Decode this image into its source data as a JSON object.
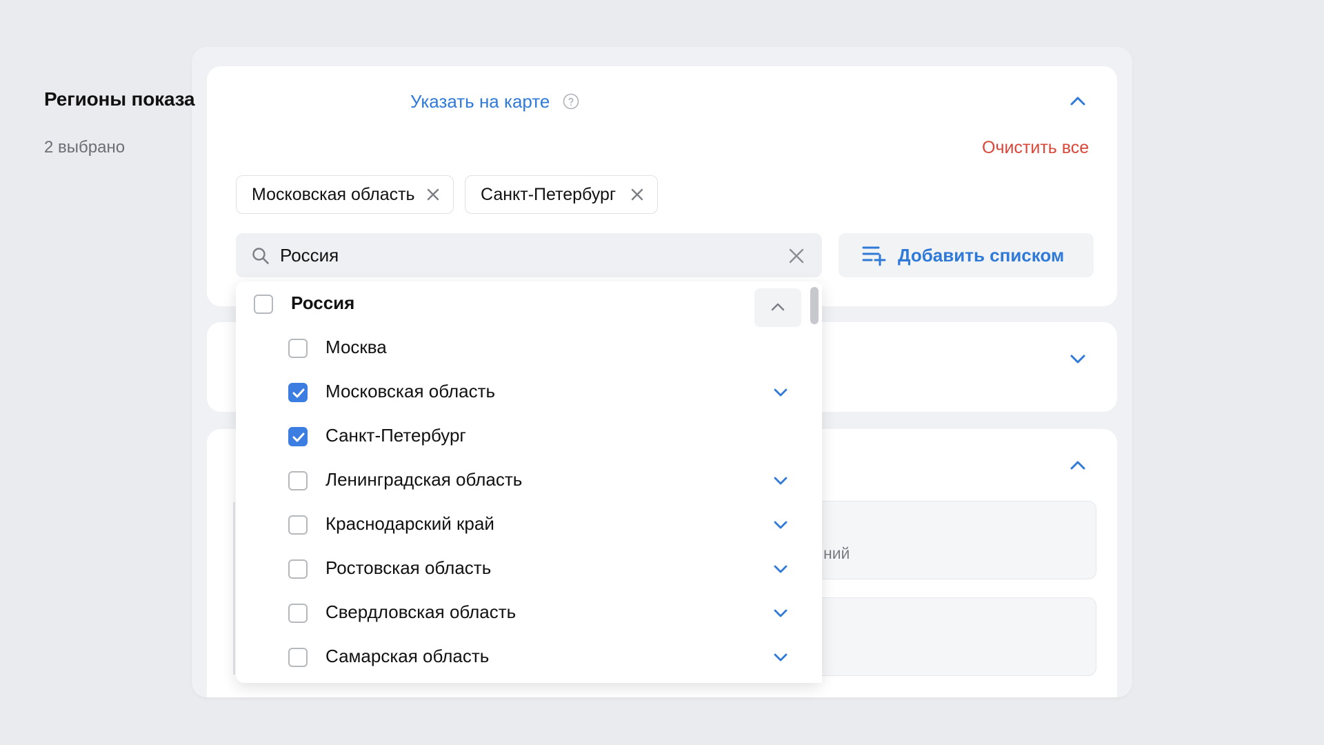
{
  "section": {
    "title": "Регионы показа",
    "map_link": "Указать на карте",
    "selected_count": "2 выбрано",
    "clear_all": "Очистить все"
  },
  "chips": [
    {
      "label": "Московская область"
    },
    {
      "label": "Санкт-Петербург"
    }
  ],
  "search": {
    "value": "Россия"
  },
  "add_list": {
    "label": "Добавить списком"
  },
  "dropdown": {
    "parent": {
      "label": "Россия",
      "checked": false,
      "expanded": true
    },
    "items": [
      {
        "label": "Москва",
        "checked": false,
        "has_children": false
      },
      {
        "label": "Московская область",
        "checked": true,
        "has_children": true
      },
      {
        "label": "Санкт-Петербург",
        "checked": true,
        "has_children": false
      },
      {
        "label": "Ленинградская область",
        "checked": false,
        "has_children": true
      },
      {
        "label": "Краснодарский край",
        "checked": false,
        "has_children": true
      },
      {
        "label": "Ростовская область",
        "checked": false,
        "has_children": true
      },
      {
        "label": "Свердловская область",
        "checked": false,
        "has_children": true
      },
      {
        "label": "Самарская область",
        "checked": false,
        "has_children": true
      }
    ]
  },
  "background": {
    "partial_text": "ний"
  },
  "colors": {
    "accent": "#2f7ad8",
    "danger": "#d9473a",
    "checkbox_checked": "#3b7de0"
  }
}
